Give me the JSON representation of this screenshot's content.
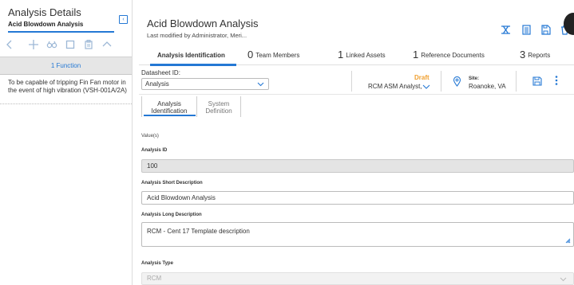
{
  "left": {
    "title": "Analysis Details",
    "subtitle": "Acid Blowdown Analysis",
    "toolbar": [
      "chevron-left-icon",
      "plus-icon",
      "binoculars-icon",
      "copy-icon",
      "paste-icon",
      "chevron-up-icon"
    ],
    "function_count": "1 Function",
    "function_desc": "To be capable of tripping Fin Fan motor in the event of high vibration (VSH-001A/2A)"
  },
  "header": {
    "title": "Acid Blowdown Analysis",
    "subtitle": "Last modified by Administrator, Meri..."
  },
  "tabs": [
    {
      "num": "",
      "label": "Analysis Identification"
    },
    {
      "num": "0",
      "label": "Team Members"
    },
    {
      "num": "1",
      "label": "Linked Assets"
    },
    {
      "num": "1",
      "label": "Reference Documents"
    },
    {
      "num": "3",
      "label": "Reports"
    }
  ],
  "datasheet": {
    "label": "Datasheet ID:",
    "value": "Analysis"
  },
  "state": {
    "status": "Draft",
    "owner": "RCM ASM Analyst,"
  },
  "site": {
    "label": "Site:",
    "value": "Roanoke, VA"
  },
  "subtabs": [
    {
      "label1": "Analysis",
      "label2": "Identification"
    },
    {
      "label1": "System",
      "label2": "Definition"
    }
  ],
  "form": {
    "section_label": "Value(s)",
    "analysis_id_label": "Analysis ID",
    "analysis_id_value": "100",
    "short_desc_label": "Analysis Short Description",
    "short_desc_value": "Acid Blowdown Analysis",
    "long_desc_label": "Analysis Long Description",
    "long_desc_value": "RCM - Cent 17 Template description",
    "type_label": "Analysis Type",
    "type_value": "RCM"
  },
  "colors": {
    "accent": "#2478d4",
    "draft": "#f0a030"
  }
}
